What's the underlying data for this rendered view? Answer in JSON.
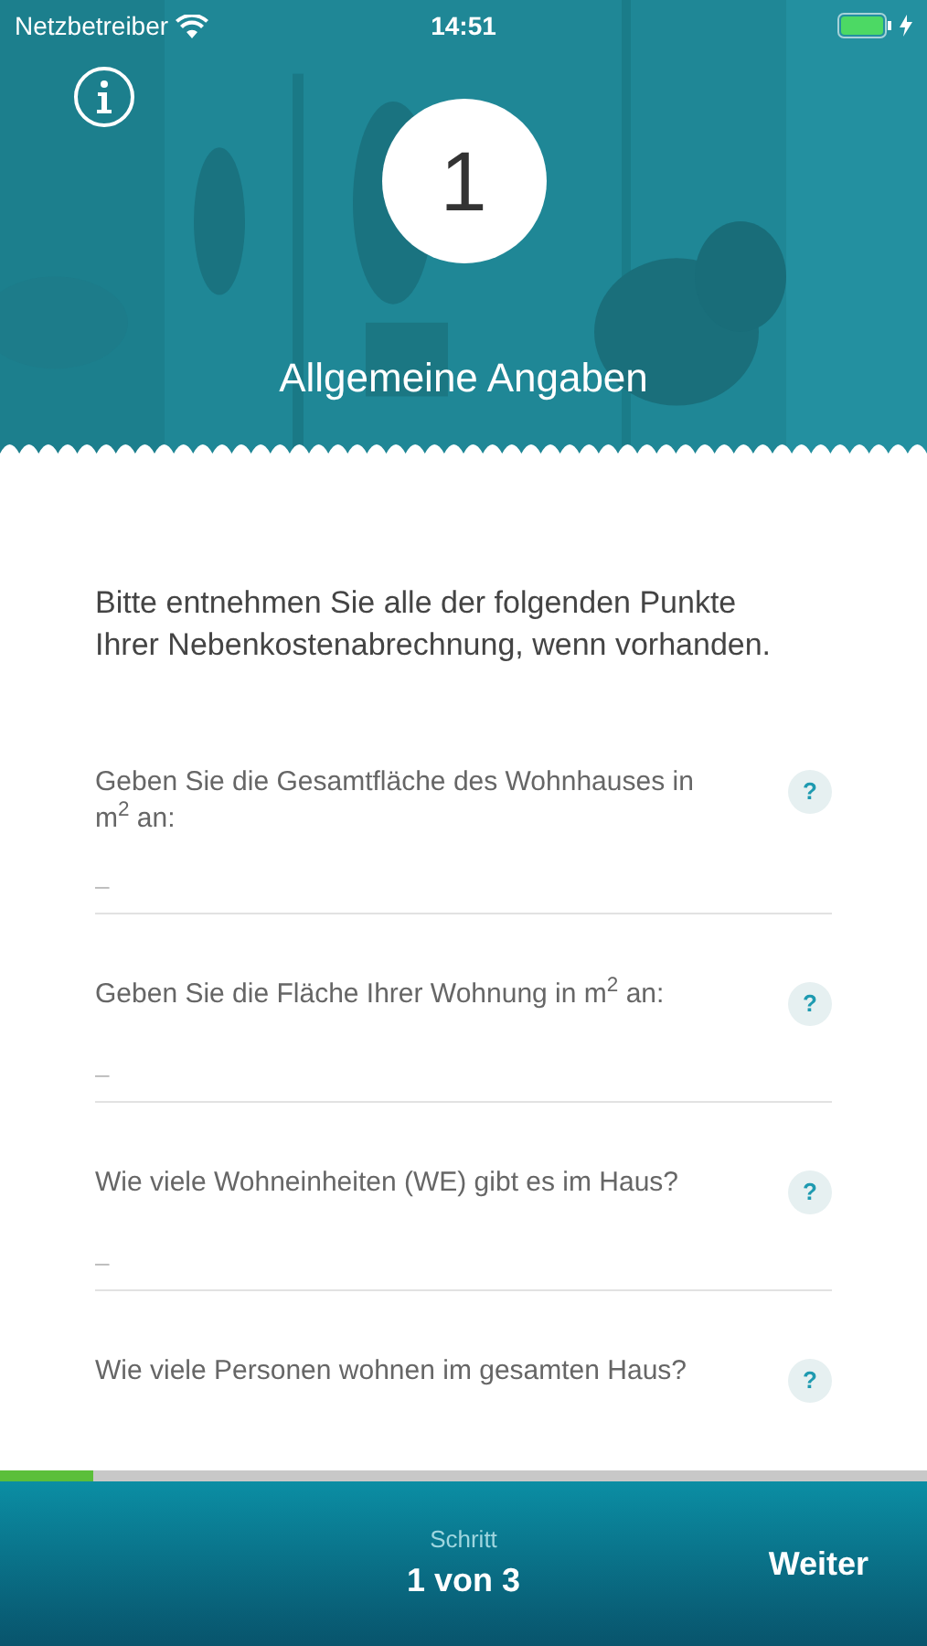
{
  "status_bar": {
    "carrier": "Netzbetreiber",
    "time": "14:51",
    "charging": true
  },
  "header": {
    "step_number": "1",
    "title": "Allgemeine Angaben"
  },
  "intro": "Bitte entnehmen Sie alle der folgenden Punkte Ihrer Nebenkostenabrechnung, wenn vorhanden.",
  "questions": [
    {
      "label": "Geben Sie die Gesamtfläche des Wohnhauses in m$^{2}$ an:",
      "placeholder": "–",
      "help": "?"
    },
    {
      "label": "Geben Sie die Fläche Ihrer Wohnung in m$^{2}$ an:",
      "placeholder": "–",
      "help": "?"
    },
    {
      "label": "Wie viele Wohneinheiten (WE) gibt es im Haus?",
      "placeholder": "–",
      "help": "?"
    },
    {
      "label": "Wie viele Personen wohnen im gesamten Haus?",
      "help": "?"
    }
  ],
  "progress": {
    "level": 0.1
  },
  "footer": {
    "step_caption": "Schritt",
    "step": "1 von 3",
    "next": "Weiter"
  }
}
